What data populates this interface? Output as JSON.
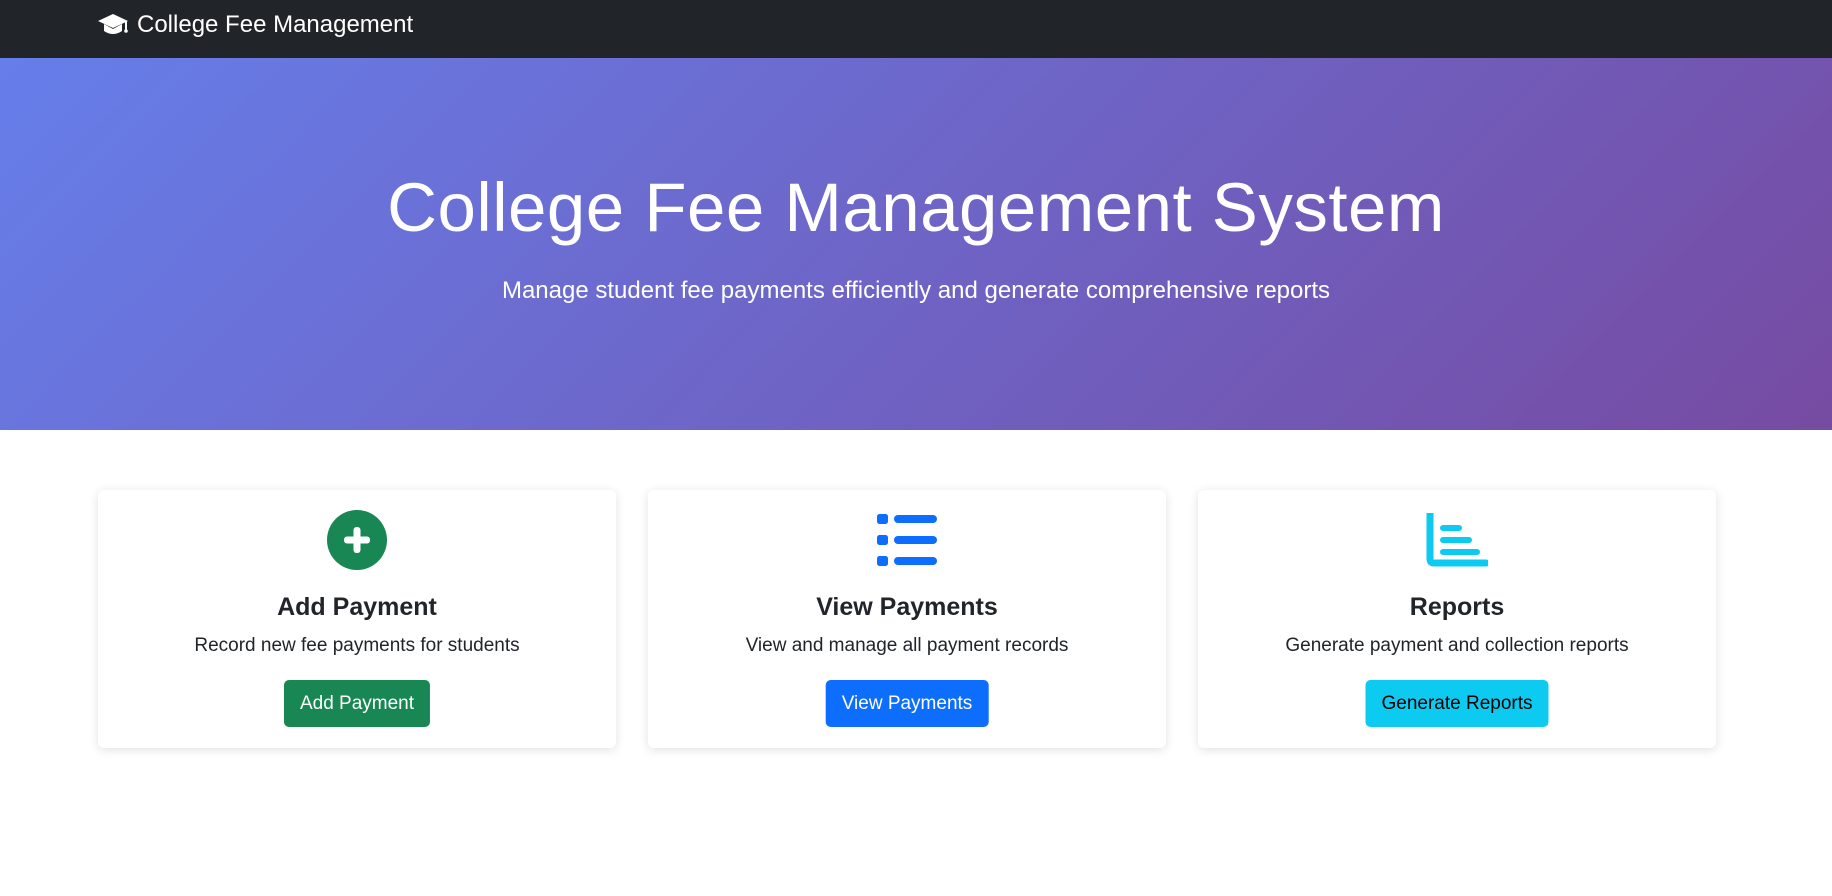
{
  "navbar": {
    "brand_label": "College Fee Management",
    "brand_icon": "graduation-cap-icon"
  },
  "hero": {
    "title": "College Fee Management System",
    "subtitle": "Manage student fee payments efficiently and generate comprehensive reports",
    "gradient_start": "#667eea",
    "gradient_end": "#764ba2"
  },
  "cards": [
    {
      "icon": "plus-circle-icon",
      "icon_color": "#198754",
      "title": "Add Payment",
      "description": "Record new fee payments for students",
      "button_label": "Add Payment",
      "button_color": "#198754"
    },
    {
      "icon": "list-icon",
      "icon_color": "#0d6efd",
      "title": "View Payments",
      "description": "View and manage all payment records",
      "button_label": "View Payments",
      "button_color": "#0d6efd"
    },
    {
      "icon": "chart-bar-icon",
      "icon_color": "#0dcaf0",
      "title": "Reports",
      "description": "Generate payment and collection reports",
      "button_label": "Generate Reports",
      "button_color": "#0dcaf0"
    }
  ]
}
